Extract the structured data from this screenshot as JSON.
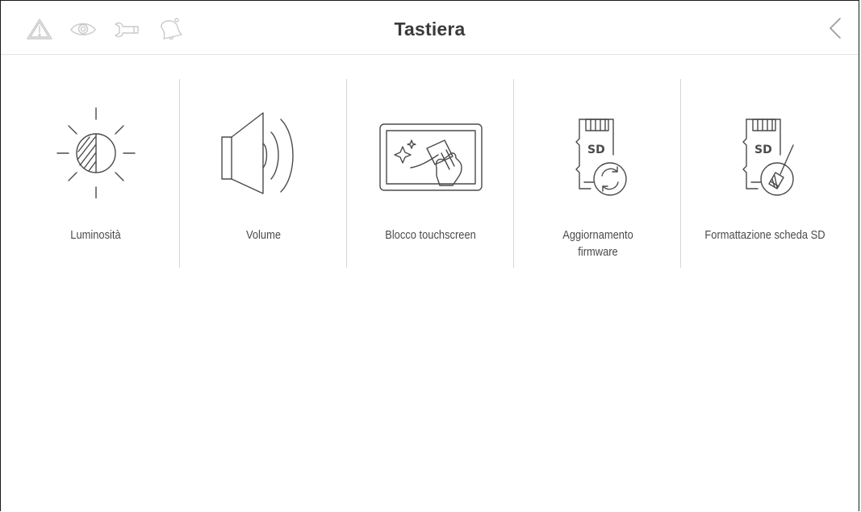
{
  "header": {
    "title": "Tastiera",
    "status_icons": [
      "warning-icon",
      "eye-icon",
      "wrench-icon",
      "bell-icon"
    ],
    "back_icon": "chevron-left-icon"
  },
  "menu": {
    "items": [
      {
        "label": "Luminosità",
        "icon": "brightness-icon"
      },
      {
        "label": "Volume",
        "icon": "speaker-icon"
      },
      {
        "label": "Blocco touchscreen",
        "icon": "touchscreen-cleaning-icon"
      },
      {
        "label": "Aggiornamento firmware",
        "icon": "sd-card-update-icon"
      },
      {
        "label": "Formattazione scheda SD",
        "icon": "sd-card-format-icon"
      }
    ]
  },
  "colors": {
    "icon_stroke": "#4a4a4a",
    "status_icon": "#c9c9c9",
    "divider": "#d6d6d6",
    "title": "#3a3a3a"
  }
}
